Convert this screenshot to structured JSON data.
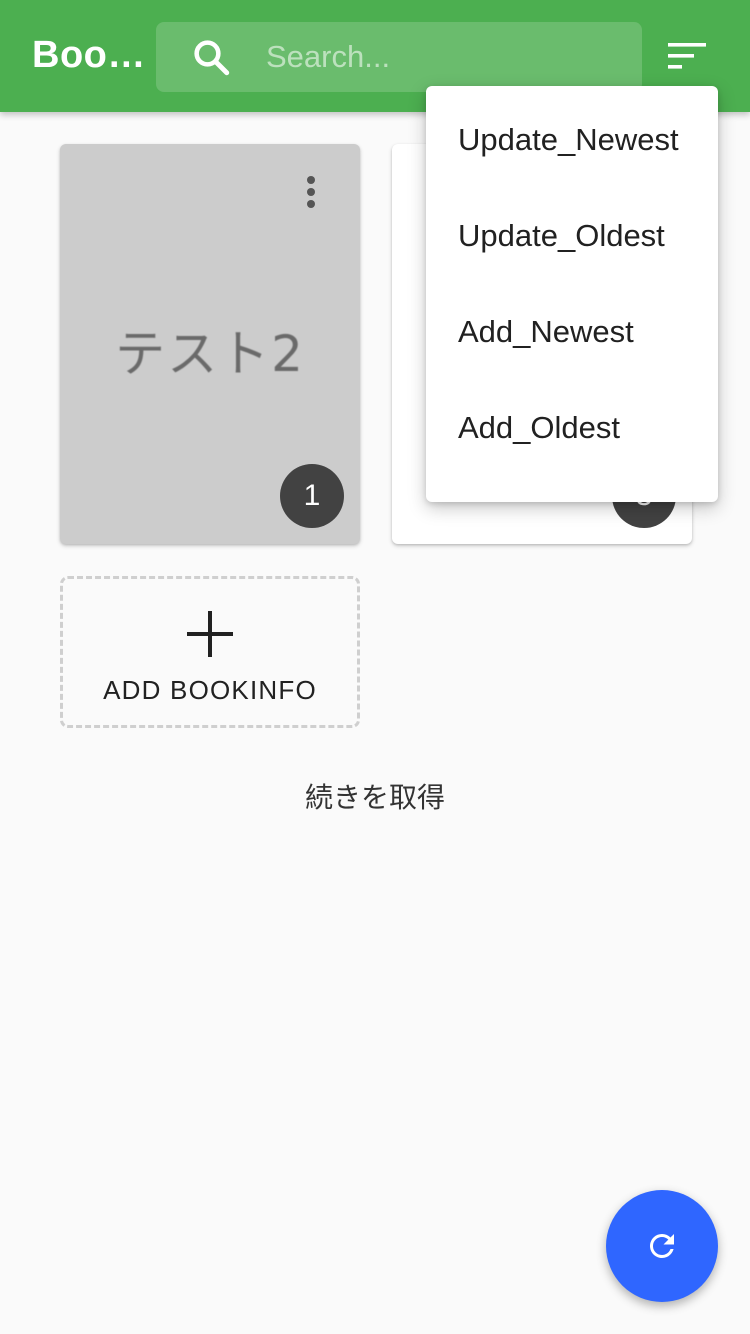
{
  "appbar": {
    "title": "Book...",
    "search_placeholder": "Search..."
  },
  "books": [
    {
      "title": "テスト2",
      "count": "1"
    },
    {
      "title": "",
      "count": "3"
    }
  ],
  "add_card": {
    "label": "ADD BOOKINFO"
  },
  "load_more": "続きを取得",
  "sort_menu": {
    "items": [
      "Update_Newest",
      "Update_Oldest",
      "Add_Newest",
      "Add_Oldest"
    ]
  },
  "icons": {
    "search": "search-icon",
    "sort": "sort-icon",
    "more": "more-vert-icon",
    "add": "plus-icon",
    "refresh": "refresh-icon"
  },
  "colors": {
    "appbar": "#4caf50",
    "fab": "#2f66ff",
    "badge": "#424242"
  }
}
